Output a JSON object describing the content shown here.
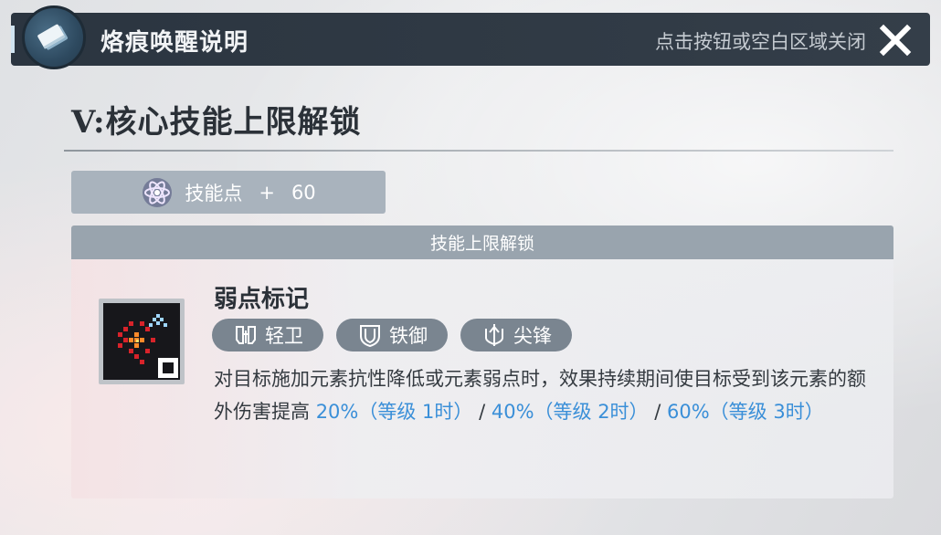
{
  "header": {
    "title": "烙痕唤醒说明",
    "close_hint": "点击按钮或空白区域关闭",
    "emblem_icon": "card-stack-icon",
    "close_icon": "close-icon"
  },
  "section": {
    "title": "V:核心技能上限解锁"
  },
  "skill_points": {
    "icon": "atom-icon",
    "label": "技能点",
    "plus": "+",
    "value": "60"
  },
  "unlock_panel": {
    "header": "技能上限解锁",
    "skill": {
      "name": "弱点标记",
      "icon": "skill-pixel-icon",
      "tags": [
        {
          "label": "轻卫",
          "icon": "light-guard-icon"
        },
        {
          "label": "铁御",
          "icon": "iron-defense-icon"
        },
        {
          "label": "尖锋",
          "icon": "spearhead-icon"
        }
      ],
      "description": {
        "text": "对目标施加元素抗性降低或元素弱点时，效果持续期间使目标受到该元素的额外伤害提高 ",
        "level1": "20%（等级 1时）",
        "sep1": " / ",
        "level2": "40%（等级 2时）",
        "sep2": " / ",
        "level3": "60%（等级 3时）"
      }
    }
  },
  "colors": {
    "header_bg": "#303a45",
    "highlight": "#3a8fd8",
    "tag_bg": "#7a8590",
    "panel_header_bg": "#99a4ae"
  }
}
